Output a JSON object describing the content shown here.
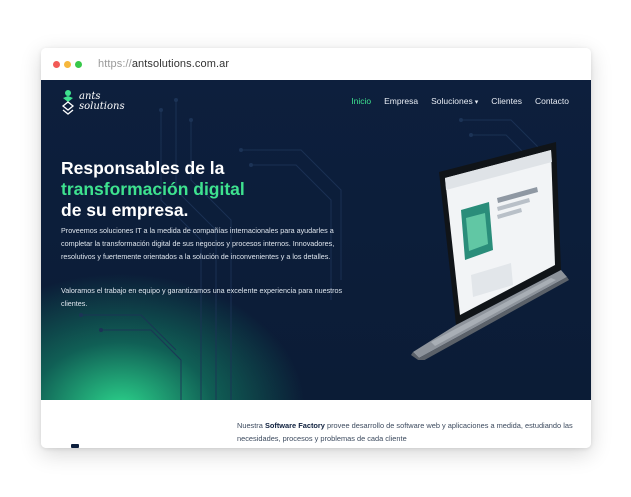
{
  "browser": {
    "url_protocol": "https://",
    "url_domain": "antsolutions.com.ar",
    "dots": [
      "#f25a56",
      "#f6b73c",
      "#37c84a"
    ]
  },
  "brand": {
    "line1": "ants",
    "line2": "solutions"
  },
  "nav": {
    "items": [
      "Inicio",
      "Empresa",
      "Soluciones",
      "Clientes",
      "Contacto"
    ],
    "active": "Inicio"
  },
  "hero": {
    "line1": "Responsables de la",
    "line2": "transformación digital",
    "line3": "de su empresa.",
    "paragraph1": "Proveemos soluciones IT a la medida de compañías internacionales para ayudarles a completar la transformación digital de sus negocios y procesos internos. Innovadores, resolutivos y fuertemente orientados a la solución de inconvenientes y a los detalles.",
    "paragraph2": "Valoramos el trabajo en equipo y garantizamos una excelente experiencia para nuestros clientes."
  },
  "software_factory": {
    "prefix": "Nuestra ",
    "bold": "Software Factory",
    "suffix": " provee desarrollo de software web y aplicaciones a medida, estudiando las necesidades, procesos y problemas de cada cliente"
  },
  "colors": {
    "accent": "#3ee28f",
    "navy": "#0d1f3d"
  }
}
